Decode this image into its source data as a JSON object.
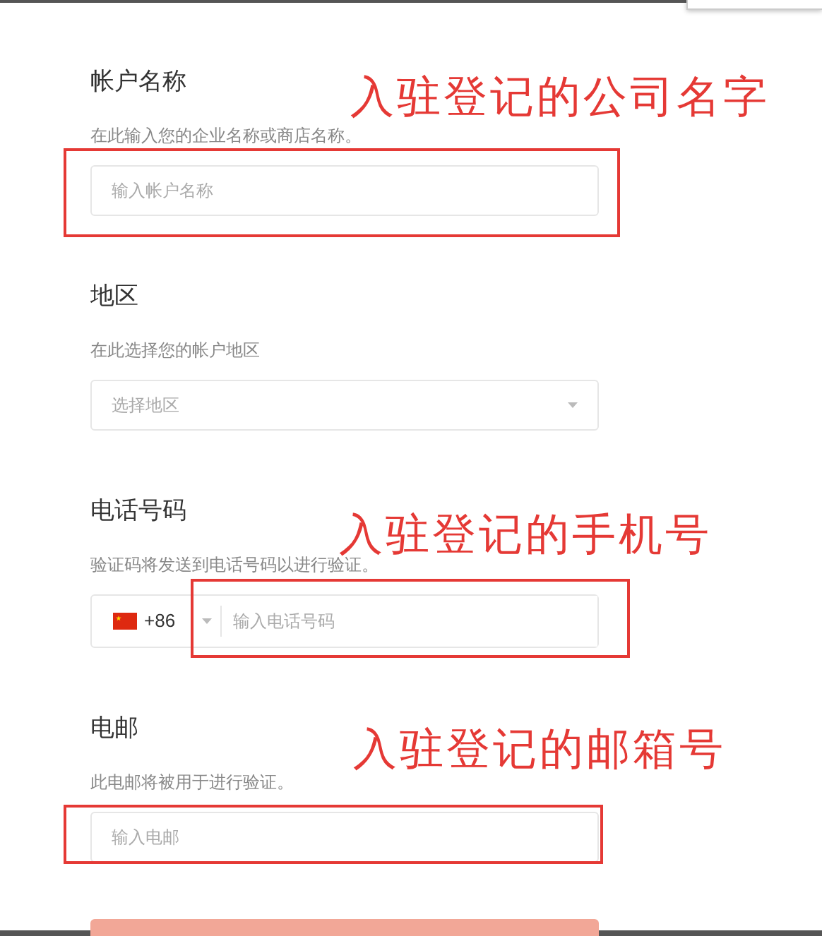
{
  "sections": [
    {
      "kind": "text",
      "title": "帐户名称",
      "description": "在此输入您的企业名称或商店名称。",
      "placeholder": "输入帐户名称"
    },
    {
      "kind": "select",
      "title": "地区",
      "description": "在此选择您的帐户地区",
      "placeholder": "选择地区"
    },
    {
      "kind": "phone",
      "title": "电话号码",
      "description": "验证码将发送到电话号码以进行验证。",
      "country_code": "+86",
      "placeholder": "输入电话号码"
    },
    {
      "kind": "text",
      "title": "电邮",
      "description": "此电邮将被用于进行验证。",
      "placeholder": "输入电邮"
    }
  ],
  "annotations": [
    {
      "text": "入驻登记的公司名字"
    },
    {
      "text": "入驻登记的手机号"
    },
    {
      "text": "入驻登记的邮箱号"
    }
  ]
}
